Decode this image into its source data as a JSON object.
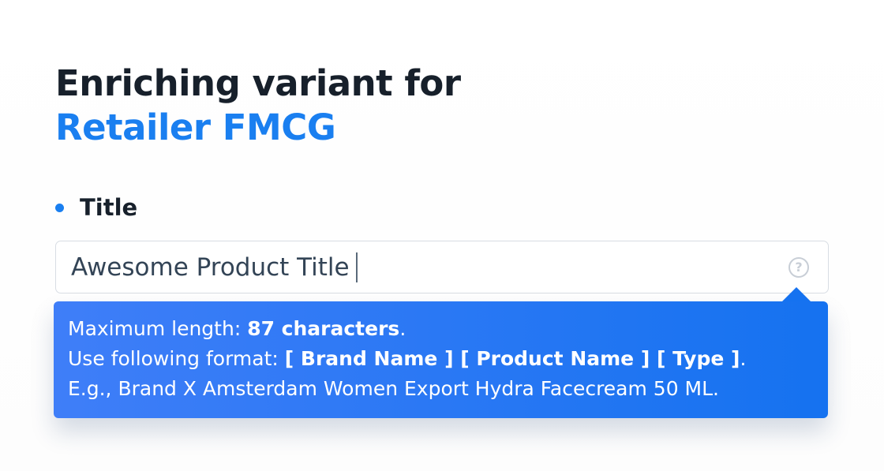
{
  "heading": {
    "line1": "Enriching variant for",
    "line2": "Retailer FMCG"
  },
  "field": {
    "label": "Title",
    "value": "Awesome Product Title",
    "help_icon": "question-circle-icon"
  },
  "tooltip": {
    "line1_prefix": "Maximum length: ",
    "line1_value": "87 characters",
    "line1_suffix": ".",
    "line2_prefix": "Use following format: ",
    "line2_format": "[ Brand Name ] [ Product Name ] [ Type ]",
    "line2_suffix": ".",
    "line3": "E.g., Brand X Amsterdam Women Export Hydra Facecream 50 ML."
  },
  "colors": {
    "accent": "#1a7ff0",
    "heading_text": "#17202b",
    "input_text": "#334456",
    "tooltip_start": "#3f7ef8",
    "tooltip_end": "#1572f0"
  }
}
